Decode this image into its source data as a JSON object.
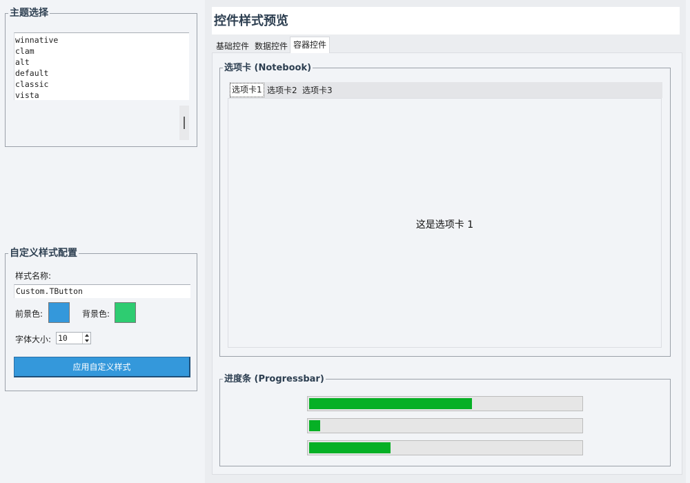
{
  "theme_panel": {
    "title": "主题选择",
    "themes": [
      "winnative",
      "clam",
      "alt",
      "default",
      "classic",
      "vista"
    ]
  },
  "custom_panel": {
    "title": "自定义样式配置",
    "style_name_label": "样式名称:",
    "style_name_value": "Custom.TButton",
    "fg_label": "前景色:",
    "fg_color": "#3498db",
    "bg_label": "背景色:",
    "bg_color": "#2ecc71",
    "font_size_label": "字体大小:",
    "font_size_value": "10",
    "apply_button": "应用自定义样式",
    "apply_button_color": "#3498db"
  },
  "preview": {
    "title": "控件样式预览",
    "tabs": [
      {
        "label": "基础控件",
        "active": false
      },
      {
        "label": "数据控件",
        "active": false
      },
      {
        "label": "容器控件",
        "active": true
      }
    ],
    "notebook_group": {
      "title": "选项卡 (Notebook)",
      "tabs": [
        {
          "label": "选项卡1",
          "active": true
        },
        {
          "label": "选项卡2",
          "active": false
        },
        {
          "label": "选项卡3",
          "active": false
        }
      ],
      "content_text": "这是选项卡 1"
    },
    "progress_group": {
      "title": "进度条 (Progressbar)",
      "bars": [
        {
          "value_fraction": 0.6
        },
        {
          "value_fraction": 0.04
        },
        {
          "value_fraction": 0.3
        }
      ],
      "fill_color": "#06b025"
    }
  }
}
